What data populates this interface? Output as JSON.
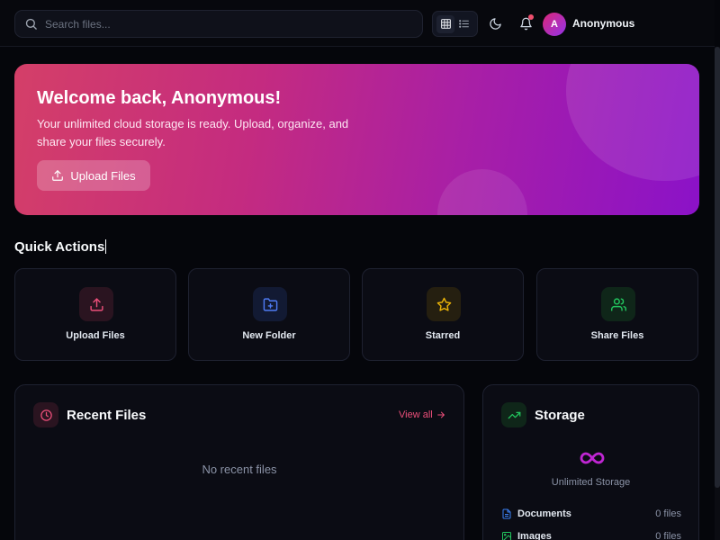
{
  "header": {
    "search_placeholder": "Search files...",
    "view_modes": [
      "grid-icon",
      "list-icon"
    ],
    "user": {
      "initial": "A",
      "name": "Anonymous"
    },
    "has_notification": true
  },
  "hero": {
    "title": "Welcome back, Anonymous!",
    "subtitle": "Your unlimited cloud storage is ready. Upload, organize, and share your files securely.",
    "button_label": "Upload Files"
  },
  "quick_actions": {
    "title": "Quick Actions",
    "items": [
      {
        "label": "Upload Files",
        "icon": "upload-icon",
        "color": "#ec4f7a"
      },
      {
        "label": "New Folder",
        "icon": "folder-plus-icon",
        "color": "#4f7cf5"
      },
      {
        "label": "Starred",
        "icon": "star-icon",
        "color": "#eab308"
      },
      {
        "label": "Share Files",
        "icon": "users-icon",
        "color": "#22c55e"
      }
    ]
  },
  "recent_files": {
    "title": "Recent Files",
    "view_all": "View all",
    "empty_text": "No recent files"
  },
  "storage": {
    "title": "Storage",
    "label": "Unlimited Storage",
    "rows": [
      {
        "name": "Documents",
        "count": "0 files",
        "icon": "document-icon",
        "color": "#3b82f6"
      },
      {
        "name": "Images",
        "count": "0 files",
        "icon": "image-icon",
        "color": "#22c55e"
      }
    ]
  },
  "colors": {
    "accent": "#ec4f7a",
    "background": "#05060b",
    "card": "#0b0c14"
  }
}
